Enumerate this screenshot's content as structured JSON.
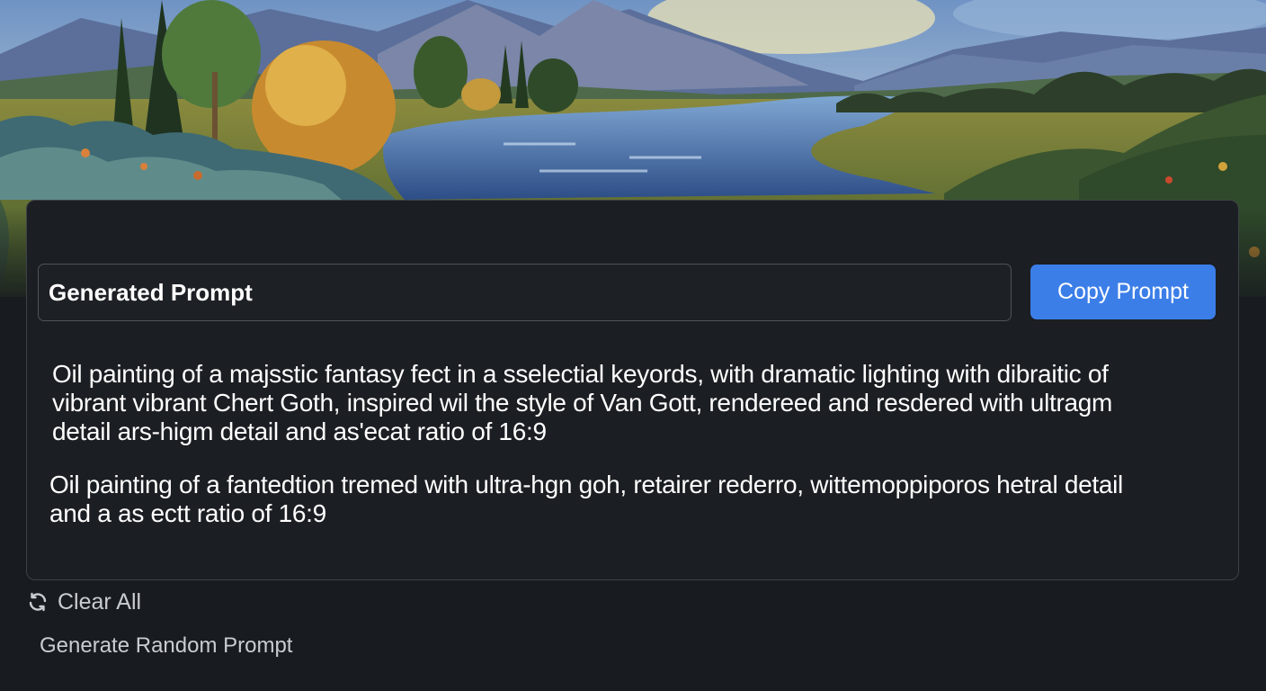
{
  "hero": {
    "image": "oil painting landscape: mountains, lake, trees"
  },
  "prompt_panel": {
    "title": "Generated Prompt",
    "copy_label": "Copy Prompt",
    "prompt_paragraphs": [
      "Oil painting of a majsstic fantasy fect in a sselectial keyords, with dramatic lighting with dibraitic of vibrant vibrant Chert Goth, inspired wil the style of Van Gott, rendereed and resdered with ultragm detail ars-higm detail and as'ecat ratio of 16:9",
      "Oil painting of a fantedtion tremed with ultra-hgn goh, retairer rederro, wittemoppiporos hetral detail and a as ectt ratio of 16:9"
    ]
  },
  "actions": {
    "clear_all_label": "Clear All",
    "clear_icon": "refresh-icon",
    "random_label": "Generate Random Prompt"
  },
  "colors": {
    "background": "#181b1f",
    "panel": "#1b1e22",
    "accent": "#3b7ee8"
  }
}
